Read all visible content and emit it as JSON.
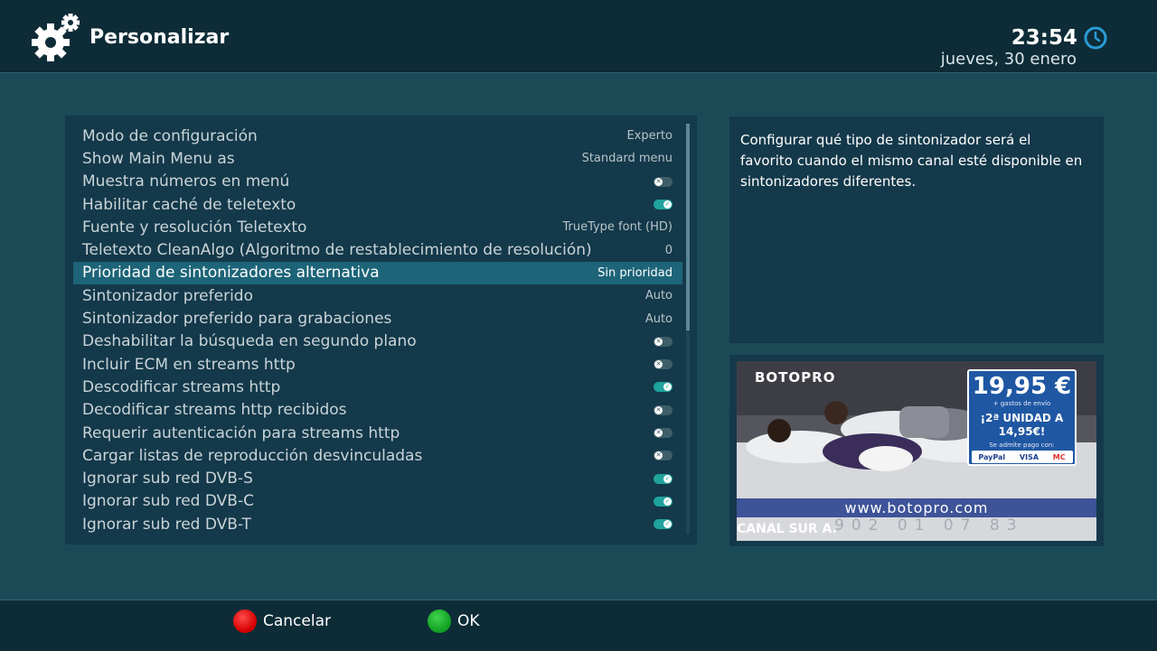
{
  "header": {
    "title": "Personalizar",
    "time": "23:54",
    "date": "jueves, 30 enero"
  },
  "settings": [
    {
      "label": "Modo de configuración",
      "value": "Experto"
    },
    {
      "label": "Show Main Menu as",
      "value": "Standard menu"
    },
    {
      "label": "Muestra números en menú",
      "toggle": "off"
    },
    {
      "label": "Habilitar caché de teletexto",
      "toggle": "on"
    },
    {
      "label": "Fuente y resolución Teletexto",
      "value": "TrueType font (HD)"
    },
    {
      "label": "Teletexto CleanAlgo (Algoritmo de restablecimiento de resolución)",
      "value": "0"
    },
    {
      "label": "Prioridad de sintonizadores alternativa",
      "value": "Sin prioridad",
      "selected": true
    },
    {
      "label": "Sintonizador preferido",
      "value": "Auto"
    },
    {
      "label": "Sintonizador preferido para grabaciones",
      "value": "Auto"
    },
    {
      "label": "Deshabilitar la búsqueda en segundo plano",
      "toggle": "off"
    },
    {
      "label": "Incluir ECM en streams http",
      "toggle": "off"
    },
    {
      "label": "Descodificar streams http",
      "toggle": "on"
    },
    {
      "label": "Decodificar streams http recibidos",
      "toggle": "off"
    },
    {
      "label": "Requerir autenticación para streams http",
      "toggle": "off"
    },
    {
      "label": "Cargar listas de reproducción  desvinculadas",
      "toggle": "off"
    },
    {
      "label": "Ignorar sub red DVB-S",
      "toggle": "on"
    },
    {
      "label": "Ignorar sub red DVB-C",
      "toggle": "on"
    },
    {
      "label": "Ignorar sub red DVB-T",
      "toggle": "on"
    }
  ],
  "description": "Configurar qué tipo de sintonizador será el favorito cuando el mismo canal esté disponible en sintonizadores diferentes.",
  "preview": {
    "brand": "BOTOPRO",
    "price": "19,95 €",
    "price_note": "+ gastos de envío",
    "promo": "¡2ª UNIDAD A 14,95€!",
    "payment_note": "Se admite pago con:",
    "payment_methods": [
      "PayPal",
      "VISA",
      "MC"
    ],
    "website": "www.botopro.com",
    "phone": "902 01 07 83",
    "channel": "CANAL SUR A."
  },
  "footer": {
    "cancel_label": "Cancelar",
    "ok_label": "OK"
  },
  "colors": {
    "background": "#1b4a57",
    "panel": "#14394a",
    "header_bar": "#0d2c37",
    "selected_row": "#1d6478",
    "toggle_on": "#1fa39d",
    "toggle_off": "#3e5f6a",
    "red_button": "#e01010",
    "green_button": "#1bb02b"
  }
}
